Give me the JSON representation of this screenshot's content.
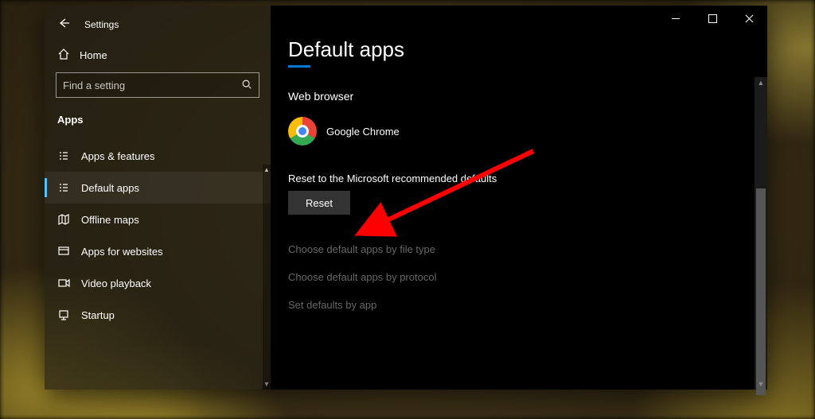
{
  "window": {
    "title": "Settings"
  },
  "sidebar": {
    "home": "Home",
    "search_placeholder": "Find a setting",
    "section": "Apps",
    "items": [
      {
        "label": "Apps & features"
      },
      {
        "label": "Default apps"
      },
      {
        "label": "Offline maps"
      },
      {
        "label": "Apps for websites"
      },
      {
        "label": "Video playback"
      },
      {
        "label": "Startup"
      }
    ]
  },
  "content": {
    "page_title": "Default apps",
    "web_browser_heading": "Web browser",
    "web_browser_app": "Google Chrome",
    "reset_heading": "Reset to the Microsoft recommended defaults",
    "reset_button": "Reset",
    "links": [
      "Choose default apps by file type",
      "Choose default apps by protocol",
      "Set defaults by app"
    ]
  }
}
